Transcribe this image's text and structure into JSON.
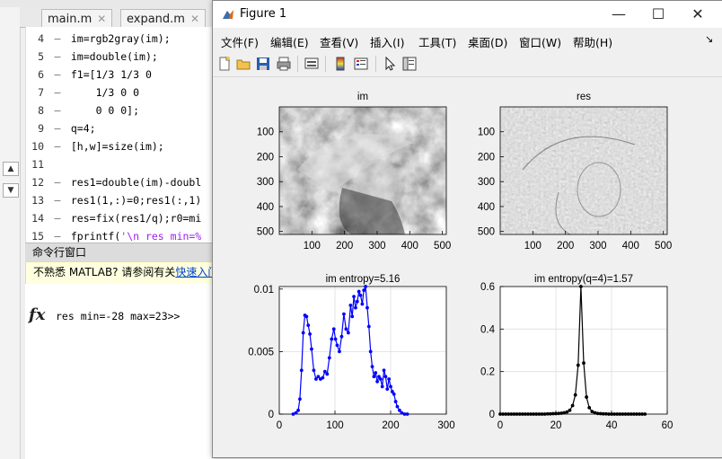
{
  "editor": {
    "tabs": [
      "main.m",
      "expand.m"
    ],
    "code_lines": [
      {
        "num": "4",
        "text": "im=rgb2gray(im);"
      },
      {
        "num": "5",
        "text": "im=double(im);"
      },
      {
        "num": "6",
        "text": "f1=[1/3 1/3 0"
      },
      {
        "num": "7",
        "text": "    1/3 0 0"
      },
      {
        "num": "8",
        "text": "    0 0 0];"
      },
      {
        "num": "9",
        "text": "q=4;"
      },
      {
        "num": "10",
        "text": "[h,w]=size(im);"
      },
      {
        "num": "11",
        "text": ""
      },
      {
        "num": "12",
        "text": "res1=double(im)-doubl"
      },
      {
        "num": "13",
        "text": "res1(1,:)=0;res1(:,1)"
      },
      {
        "num": "14",
        "text": "res=fix(res1/q);r0=mi"
      },
      {
        "num": "15",
        "text": "fprintf('\\n res min=%"
      }
    ]
  },
  "command_window": {
    "title": "命令行窗口",
    "banner_text": "不熟悉 MATLAB? 请参阅有关",
    "banner_link": "快速入门",
    "prompt_symbol": "fx",
    "output": "res min=-28 max=23>>"
  },
  "figure": {
    "title": "Figure 1",
    "window_buttons": [
      "—",
      "☐",
      "✕"
    ],
    "menus": [
      "文件(F)",
      "编辑(E)",
      "查看(V)",
      "插入(I)",
      "工具(T)",
      "桌面(D)",
      "窗口(W)",
      "帮助(H)"
    ],
    "toolbar_icons": [
      "new-figure-icon",
      "open-file-icon",
      "save-icon",
      "print-icon",
      "link-plot-icon",
      "colorbar-icon",
      "legend-icon",
      "pointer-icon",
      "property-inspector-icon"
    ]
  },
  "chart_data": [
    {
      "type": "image",
      "title": "im",
      "xticks": [
        100,
        200,
        300,
        400,
        500
      ],
      "yticks": [
        100,
        200,
        300,
        400,
        500
      ],
      "xlim": [
        0,
        512
      ],
      "ylim": [
        0,
        512
      ]
    },
    {
      "type": "image",
      "title": "res",
      "xticks": [
        100,
        200,
        300,
        400,
        500
      ],
      "yticks": [
        100,
        200,
        300,
        400,
        500
      ],
      "xlim": [
        0,
        512
      ],
      "ylim": [
        0,
        512
      ]
    },
    {
      "type": "line",
      "title": "im entropy=5.16",
      "xlim": [
        0,
        300
      ],
      "ylim": [
        0,
        0.0102
      ],
      "xticks": [
        0,
        100,
        200,
        300
      ],
      "yticks": [
        0,
        0.005,
        0.01
      ],
      "ytick_labels": [
        "0",
        "0.005",
        "0.01"
      ],
      "grid": true,
      "color": "#0000ff",
      "x": [
        25,
        30,
        34,
        37,
        40,
        43,
        46,
        49,
        52,
        55,
        58,
        62,
        66,
        70,
        74,
        78,
        82,
        86,
        90,
        94,
        98,
        101,
        104,
        108,
        112,
        116,
        120,
        124,
        128,
        131,
        134,
        137,
        140,
        143,
        146,
        149,
        152,
        155,
        158,
        161,
        164,
        167,
        170,
        173,
        176,
        179,
        182,
        185,
        188,
        191,
        194,
        197,
        200,
        203,
        206,
        209,
        212,
        216,
        220,
        225,
        230
      ],
      "y": [
        0,
        0.0001,
        0.0003,
        0.0012,
        0.0035,
        0.0065,
        0.0079,
        0.0078,
        0.0071,
        0.0064,
        0.0052,
        0.0035,
        0.0028,
        0.003,
        0.0028,
        0.0029,
        0.0034,
        0.0032,
        0.0045,
        0.006,
        0.0068,
        0.006,
        0.0055,
        0.005,
        0.0062,
        0.008,
        0.0068,
        0.0065,
        0.0087,
        0.0078,
        0.0094,
        0.0085,
        0.009,
        0.0098,
        0.0095,
        0.0088,
        0.0099,
        0.0102,
        0.0085,
        0.007,
        0.005,
        0.0038,
        0.003,
        0.0033,
        0.0026,
        0.003,
        0.0028,
        0.0022,
        0.0035,
        0.003,
        0.002,
        0.0028,
        0.0022,
        0.0018,
        0.0016,
        0.001,
        0.0006,
        0.0003,
        0.0001,
        0,
        0
      ]
    },
    {
      "type": "line",
      "title": "im entropy(q=4)=1.57",
      "xlim": [
        0,
        60
      ],
      "ylim": [
        0,
        0.6
      ],
      "xticks": [
        0,
        20,
        40,
        60
      ],
      "yticks": [
        0,
        0.2,
        0.4,
        0.6
      ],
      "ytick_labels": [
        "0",
        "0.2",
        "0.4",
        "0.6"
      ],
      "grid": true,
      "color": "#000000",
      "x": [
        0,
        1,
        2,
        3,
        4,
        5,
        6,
        7,
        8,
        9,
        10,
        11,
        12,
        13,
        14,
        15,
        16,
        17,
        18,
        19,
        20,
        21,
        22,
        23,
        24,
        25,
        26,
        27,
        28,
        29,
        30,
        31,
        32,
        33,
        34,
        35,
        36,
        37,
        38,
        39,
        40,
        41,
        42,
        43,
        44,
        45,
        46,
        47,
        48,
        49,
        50,
        51,
        52
      ],
      "y": [
        0,
        0,
        0,
        0,
        0,
        0,
        0,
        0,
        0,
        0,
        0,
        0,
        0,
        0,
        0,
        0,
        0,
        0.001,
        0.001,
        0.002,
        0.002,
        0.003,
        0.004,
        0.006,
        0.01,
        0.018,
        0.04,
        0.09,
        0.23,
        0.61,
        0.24,
        0.08,
        0.03,
        0.012,
        0.006,
        0.003,
        0.002,
        0.001,
        0.001,
        0,
        0,
        0,
        0,
        0,
        0,
        0,
        0,
        0,
        0,
        0,
        0,
        0,
        0
      ]
    }
  ]
}
